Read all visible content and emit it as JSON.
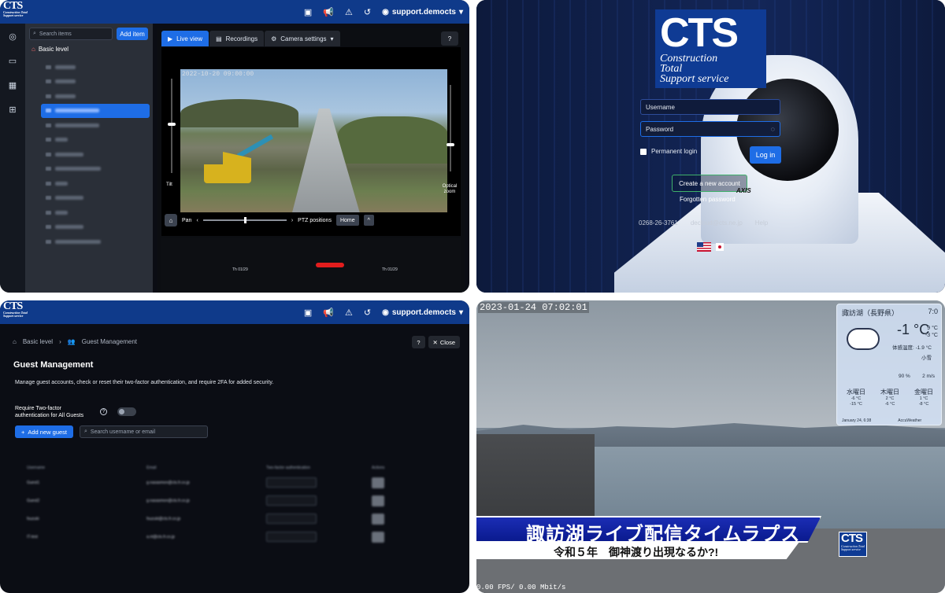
{
  "panel1": {
    "logo": {
      "big": "CTS",
      "small": "Construction Total Support service"
    },
    "top_icons": [
      "gallery-icon",
      "megaphone-icon",
      "warning-icon",
      "history-icon"
    ],
    "user": "support.democts",
    "search_placeholder": "Search items",
    "add_item": "Add item",
    "tree_root": "Basic level",
    "tabs": [
      {
        "label": "Live view"
      },
      {
        "label": "Recordings"
      },
      {
        "label": "Camera settings"
      }
    ],
    "timestamp": "2022-10-20 09:00:00",
    "tilt_label": "Tilt",
    "zoom_label": "Optical zoom",
    "pan_label": "Pan",
    "ptz_label": "PTZ positions",
    "home_label": "Home",
    "timeline_labels": [
      "Th 01/29",
      "Th 01/29",
      "Th 01/29"
    ],
    "colors": {
      "accent": "#1e6de6",
      "topbar": "#0f3a8a"
    }
  },
  "panel2": {
    "logo_big": "CTS",
    "logo_sub": [
      "Construction",
      "Total",
      "Support service"
    ],
    "username_placeholder": "Username",
    "password_placeholder": "Password",
    "permanent_login": "Permanent login",
    "login_button": "Log in",
    "create_account": "Create a new account",
    "forgot_password": "Forgotten password",
    "camera_brand": "AXIS",
    "phone": "0268-26-3761",
    "email": "decloud@cts.ne.jp",
    "help": "Help"
  },
  "panel3": {
    "user": "support.democts",
    "breadcrumb": [
      "Basic level",
      "Guest Management"
    ],
    "close_label": "Close",
    "title": "Guest Management",
    "description": "Manage guest accounts, check or reset their two-factor authentication, and require 2FA for added security.",
    "require_2fa": [
      "Require Two-factor",
      "authentication for All Guests"
    ],
    "add_guest": "Add new guest",
    "search_placeholder": "Search username or email",
    "table_headers": [
      "Username",
      "Email",
      "Two-factor authentication",
      "Actions"
    ],
    "rows": [
      {
        "username": "Guest1",
        "email": "g.nasasmon@cts.fr.co.jp"
      },
      {
        "username": "Guest2",
        "email": "g.nasasmon@cts.fr.co.jp"
      },
      {
        "username": "fsuzuki",
        "email": "fsuzuki@cts.fr.co.jp"
      },
      {
        "username": "IT-test",
        "email": "a.nt@cts.fr.co.jp"
      }
    ]
  },
  "panel4": {
    "timestamp": "2023-01-24 07:02:01",
    "weather": {
      "location": "諏訪湖（長野県）",
      "time": "7:0",
      "temp": "-1 °C",
      "hi_lo": [
        "9 °C",
        "-3 °C"
      ],
      "feels": "体感温度: -1.9 °C",
      "cond": "小雪",
      "humidity": "90 %",
      "wind": "2 m/s",
      "days": [
        {
          "name": "水曜日",
          "hi": "-6 °C",
          "lo": "-15 °C"
        },
        {
          "name": "木曜日",
          "hi": "2 °C",
          "lo": "-6 °C"
        },
        {
          "name": "金曜日",
          "hi": "1 °C",
          "lo": "-8 °C"
        }
      ],
      "footer_time": "January 24, 6:38",
      "footer_brand": "AccuWeather"
    },
    "banner": "諏訪湖ライブ配信タイムラプス",
    "subtitle": "令和５年　御神渡り出現なるか?!",
    "logo_big": "CTS",
    "logo_sub": "Construction Total Support service",
    "fps": "0.00 FPS/ 0.00 Mbit/s"
  }
}
